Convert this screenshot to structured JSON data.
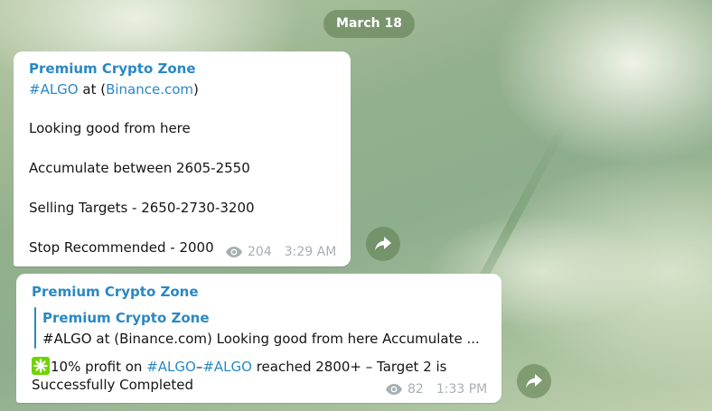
{
  "date_separator": "March 18",
  "colors": {
    "link": "#2a88c4",
    "meta": "#a8afb3",
    "bubble": "#ffffff",
    "emoji_green": "#6dd400"
  },
  "message1": {
    "sender": "Premium Crypto Zone",
    "hashtag": "#ALGO",
    "at_text": " at (",
    "domain_link": "Binance.com",
    "close_paren": ")",
    "line_looking": "Looking good from here",
    "line_accumulate": "Accumulate between 2605-2550",
    "line_targets": "Selling Targets - 2650-2730-3200",
    "line_stop": "Stop Recommended - 2000",
    "views": "204",
    "time": "3:29 AM",
    "views_icon": "eye-icon",
    "share_icon": "share-arrow-icon"
  },
  "message2": {
    "sender": "Premium Crypto Zone",
    "reply_sender": "Premium Crypto Zone",
    "reply_preview": "#ALGO at (Binance.com)  Looking good from here  Accumulate ...",
    "emoji": "check-emoji",
    "text_prefix": "10% profit on ",
    "hashtag1": "#ALGO",
    "dash": "–",
    "hashtag2": "#ALGO",
    "text_suffix": " reached 2800+ – Target 2 is",
    "text_line2": "Successfully Completed",
    "views": "82",
    "time": "1:33 PM",
    "views_icon": "eye-icon",
    "share_icon": "share-arrow-icon"
  }
}
